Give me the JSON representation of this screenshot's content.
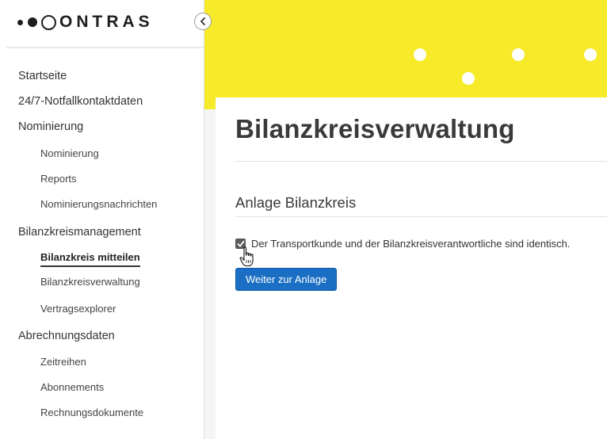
{
  "logo": {
    "text": "ONTRAS"
  },
  "sidebar": {
    "collapse_icon": "chevron-left-icon",
    "items": [
      {
        "label": "Startseite",
        "level": 1
      },
      {
        "label": "24/7-Notfallkontaktdaten",
        "level": 1
      },
      {
        "label": "Nominierung",
        "level": 1
      },
      {
        "label": "Nominierung",
        "level": 2
      },
      {
        "label": "Reports",
        "level": 2
      },
      {
        "label": "Nominierungsnachrichten",
        "level": 2
      },
      {
        "label": "Bilanzkreismanagement",
        "level": 1
      },
      {
        "label": "Bilanzkreis mitteilen",
        "level": 2,
        "active": true
      },
      {
        "label": "Bilanzkreisverwaltung",
        "level": 2
      },
      {
        "label": "Vertragsexplorer",
        "level": 2
      },
      {
        "label": "Abrechnungsdaten",
        "level": 1
      },
      {
        "label": "Zeitreihen",
        "level": 2
      },
      {
        "label": "Abonnements",
        "level": 2
      },
      {
        "label": "Rechnungsdokumente",
        "level": 2
      }
    ]
  },
  "main": {
    "title": "Bilanzkreisverwaltung",
    "section_title": "Anlage Bilanzkreis",
    "checkbox": {
      "checked": true,
      "label": "Der Transportkunde und der Bilanzkreisverantwortliche sind identisch."
    },
    "primary_button": "Weiter zur Anlage"
  },
  "colors": {
    "banner": "#f6ea29",
    "primary_button": "#1a6fc4",
    "text": "#333333"
  }
}
